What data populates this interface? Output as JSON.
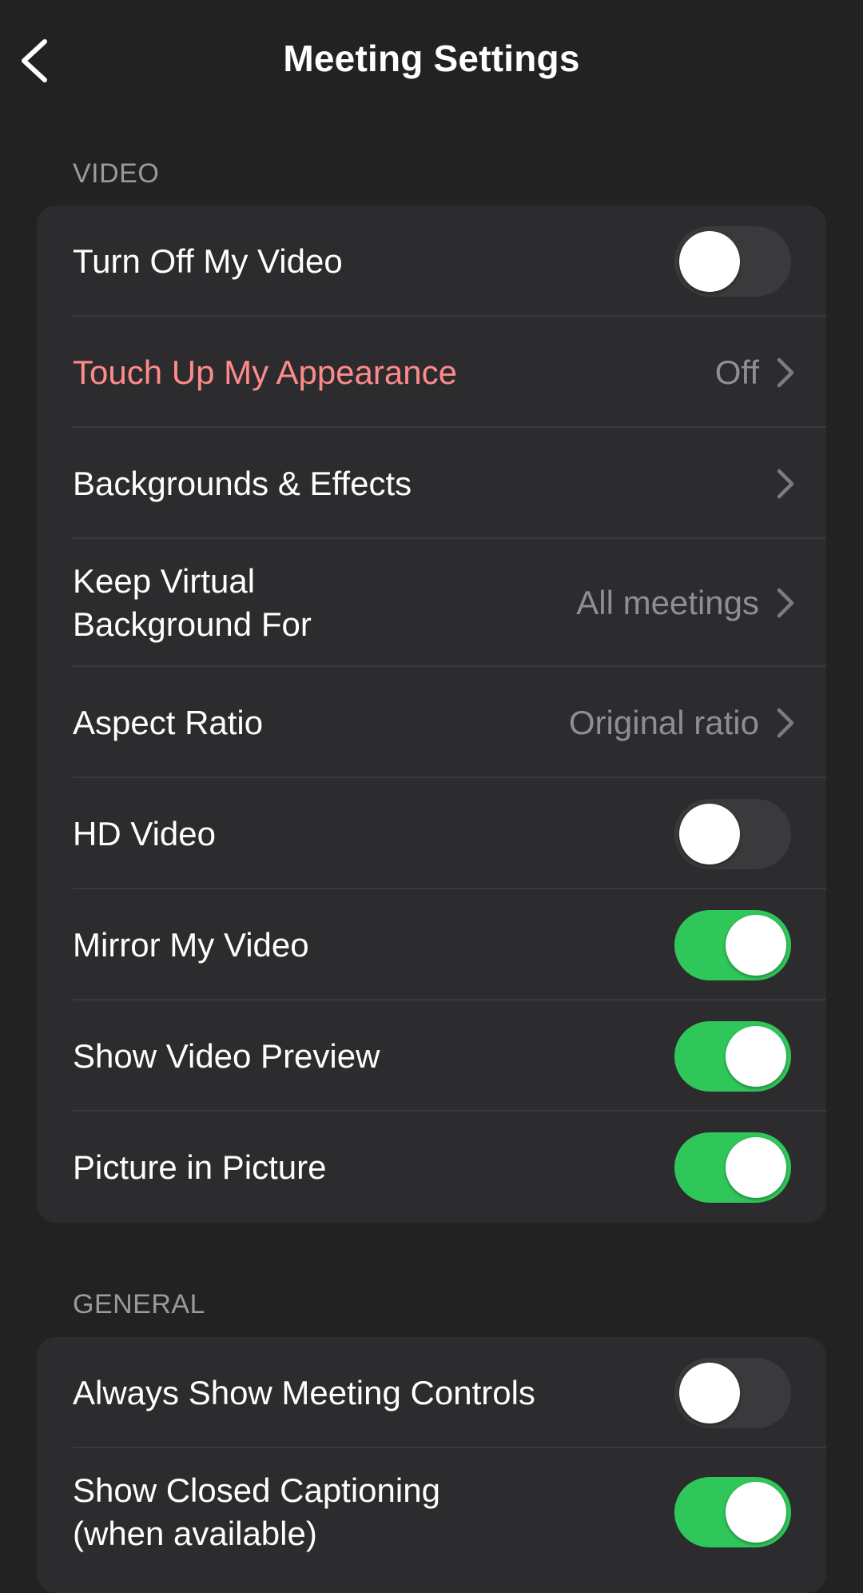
{
  "header": {
    "title": "Meeting Settings",
    "back_icon": "chevron-left-icon"
  },
  "colors": {
    "background": "#222222",
    "group_background": "#2c2c2e",
    "toggle_on": "#30c75a",
    "toggle_off": "#3a3a3c",
    "highlight": "#ab2d30",
    "highlight_text": "#ff8a8a",
    "secondary_text": "#8e8e93"
  },
  "sections": {
    "video": {
      "header": "VIDEO",
      "rows": [
        {
          "label": "Turn Off My Video",
          "type": "toggle",
          "on": false
        },
        {
          "label": "Touch Up My Appearance",
          "type": "disclosure",
          "value": "Off",
          "highlighted": true
        },
        {
          "label": "Backgrounds & Effects",
          "type": "disclosure",
          "value": ""
        },
        {
          "label": "Keep Virtual Background For",
          "type": "disclosure",
          "value": "All meetings"
        },
        {
          "label": "Aspect Ratio",
          "type": "disclosure",
          "value": "Original ratio"
        },
        {
          "label": "HD Video",
          "type": "toggle",
          "on": false
        },
        {
          "label": "Mirror My Video",
          "type": "toggle",
          "on": true
        },
        {
          "label": "Show Video Preview",
          "type": "toggle",
          "on": true
        },
        {
          "label": "Picture in Picture",
          "type": "toggle",
          "on": true
        }
      ]
    },
    "general": {
      "header": "GENERAL",
      "rows": [
        {
          "label": "Always Show Meeting Controls",
          "type": "toggle",
          "on": false
        },
        {
          "label": "Show Closed Captioning (when available)",
          "type": "toggle",
          "on": true
        }
      ]
    }
  }
}
